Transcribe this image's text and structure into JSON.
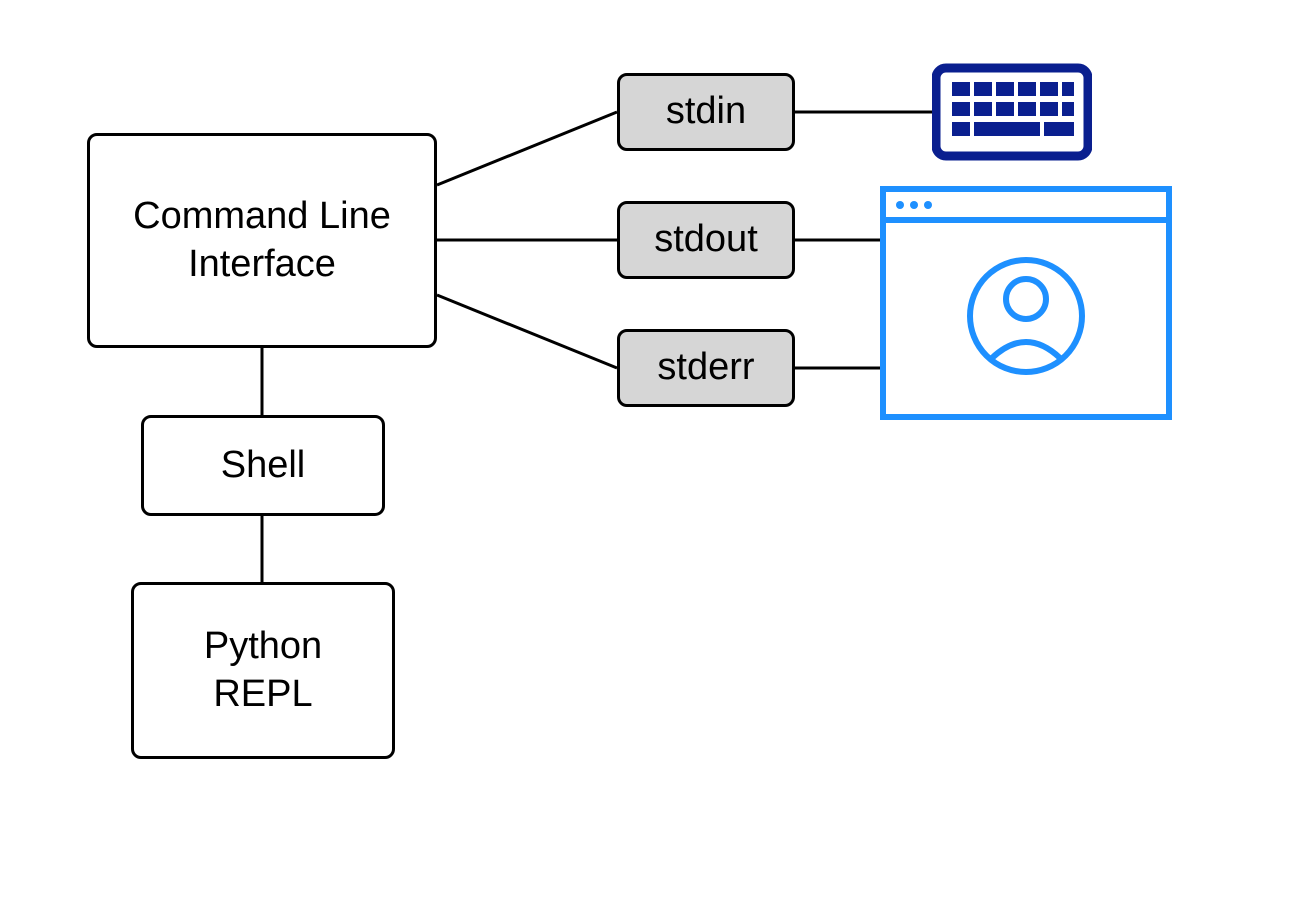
{
  "nodes": {
    "cli": {
      "label": "Command Line\nInterface"
    },
    "shell": {
      "label": "Shell"
    },
    "repl": {
      "label": "Python\nREPL"
    },
    "stdin": {
      "label": "stdin"
    },
    "stdout": {
      "label": "stdout"
    },
    "stderr": {
      "label": "stderr"
    }
  },
  "icons": {
    "keyboard": {
      "name": "keyboard-icon",
      "color": "#0a1f8f"
    },
    "terminal": {
      "name": "terminal-user-window-icon",
      "color": "#1e90ff"
    }
  },
  "edges": [
    {
      "from": "cli",
      "to": "stdin"
    },
    {
      "from": "cli",
      "to": "stdout"
    },
    {
      "from": "cli",
      "to": "stderr"
    },
    {
      "from": "cli",
      "to": "shell"
    },
    {
      "from": "shell",
      "to": "repl"
    },
    {
      "from": "stdin",
      "to": "keyboard"
    },
    {
      "from": "stdout",
      "to": "terminal"
    },
    {
      "from": "stderr",
      "to": "terminal"
    }
  ],
  "colors": {
    "node_border": "#000000",
    "node_fill": "#ffffff",
    "stream_fill": "#d6d6d6",
    "edge": "#000000",
    "keyboard": "#0a1f8f",
    "terminal": "#1e90ff"
  }
}
